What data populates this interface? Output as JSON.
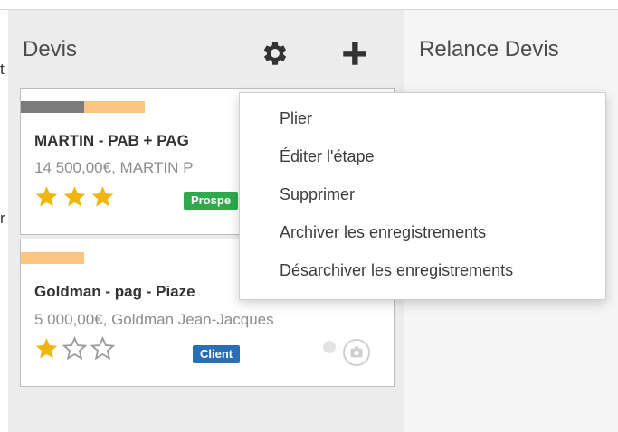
{
  "left_fragments": [
    "t",
    "r"
  ],
  "columns": [
    {
      "title": "Devis"
    },
    {
      "title": "Relance Devis"
    }
  ],
  "toolbar_icons": [
    "gear-icon",
    "plus-icon"
  ],
  "cards": [
    {
      "title": "MARTIN - PAB + PAG",
      "subtitle": "14 500,00€, MARTIN P",
      "rating": 3,
      "max_rating": 3,
      "badge": "Prospe",
      "badge_color": "#2ea94b",
      "color_tags": [
        "#7b7b7b",
        "#fbc584"
      ]
    },
    {
      "title": "Goldman - pag - Piaze",
      "subtitle": "5 000,00€, Goldman Jean-Jacques",
      "rating": 1,
      "max_rating": 3,
      "badge": "Client",
      "badge_color": "#2a6fb5",
      "color_tags": [
        "#fbc584"
      ]
    }
  ],
  "menu": {
    "items": [
      "Plier",
      "Éditer l'étape",
      "Supprimer",
      "Archiver les enregistrements",
      "Désarchiver les enregistrements"
    ]
  },
  "colors": {
    "star_filled": "#f1b50f",
    "star_empty": "#9a9a9a",
    "column_bg": "#ececec"
  }
}
